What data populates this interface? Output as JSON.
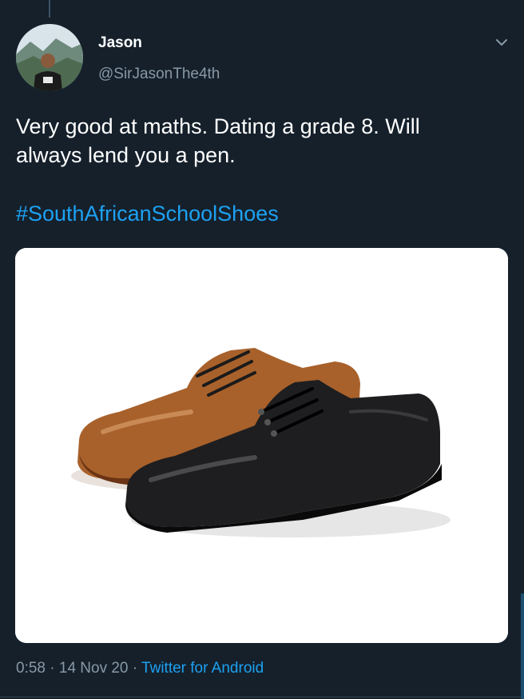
{
  "tweet": {
    "author": {
      "display_name": "Jason",
      "handle": "@SirJasonThe4th",
      "avatar_icon": "profile-photo-avatar"
    },
    "text_lines": [
      "Very good at maths. Dating a grade 8. Will",
      "always lend you a pen."
    ],
    "hashtag": "#SouthAfricanSchoolShoes",
    "media": {
      "icon": "school-shoes-photo"
    },
    "meta": {
      "time": "0:58",
      "separator": "·",
      "date": "14 Nov 20",
      "source": "Twitter for Android"
    },
    "menu_icon": "chevron-down-icon"
  },
  "colors": {
    "background": "#15202b",
    "text_primary": "#ffffff",
    "text_secondary": "#8899a6",
    "link": "#1da1f2",
    "divider": "#38444d"
  }
}
